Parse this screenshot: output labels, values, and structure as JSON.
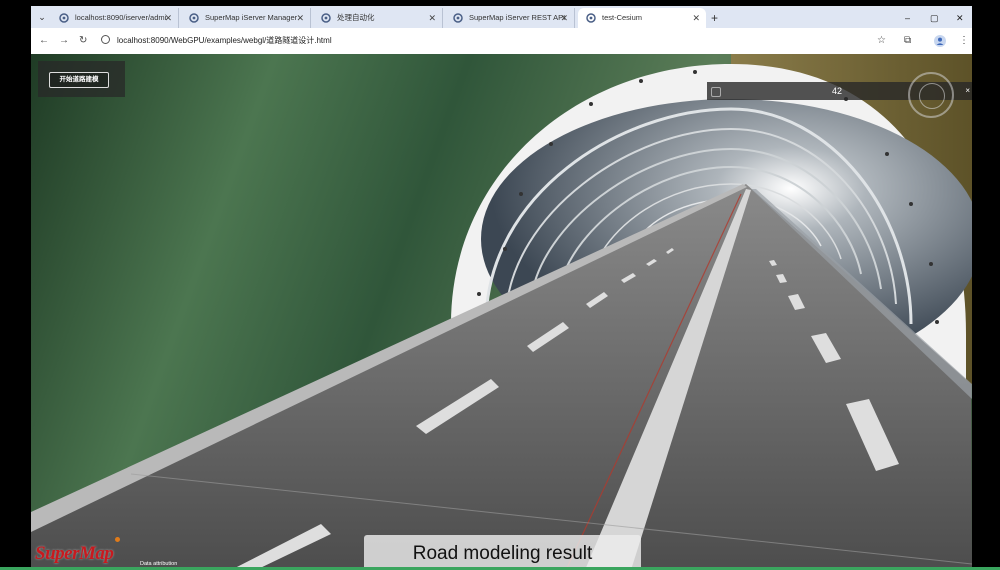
{
  "browser": {
    "tabs": [
      {
        "title": "localhost:8090/iserver/admi",
        "active": false
      },
      {
        "title": "SuperMap iServer Manager",
        "active": false
      },
      {
        "title": "处理自动化",
        "active": false
      },
      {
        "title": "SuperMap iServer REST API",
        "active": false
      },
      {
        "title": "test-Cesium",
        "active": true
      }
    ],
    "new_tab_label": "+",
    "url": "localhost:8090/WebGPU/examples/webgl/道路隧道设计.html",
    "controls": {
      "minimize": "–",
      "maximize": "▢",
      "close": "✕"
    }
  },
  "app": {
    "start_button_label": "开始道路建模",
    "readout_value": "42",
    "readout_close": "×",
    "logo_text": "SuperMap",
    "attribution": "Data attribution"
  },
  "caption": "Road modeling result",
  "colors": {
    "tab_strip": "#dfe6f3",
    "road": "#5a5a5a",
    "tunnel_ring": "#f2f2f2",
    "logo": "#c8191e",
    "accent_line": "#3aa55e"
  },
  "icons": [
    "tab-search-icon",
    "supermap-favicon-icon",
    "back-arrow-icon",
    "forward-arrow-icon",
    "reload-icon",
    "site-info-icon",
    "bookmark-star-icon",
    "extensions-icon",
    "profile-icon",
    "more-menu-icon",
    "compass-icon"
  ]
}
